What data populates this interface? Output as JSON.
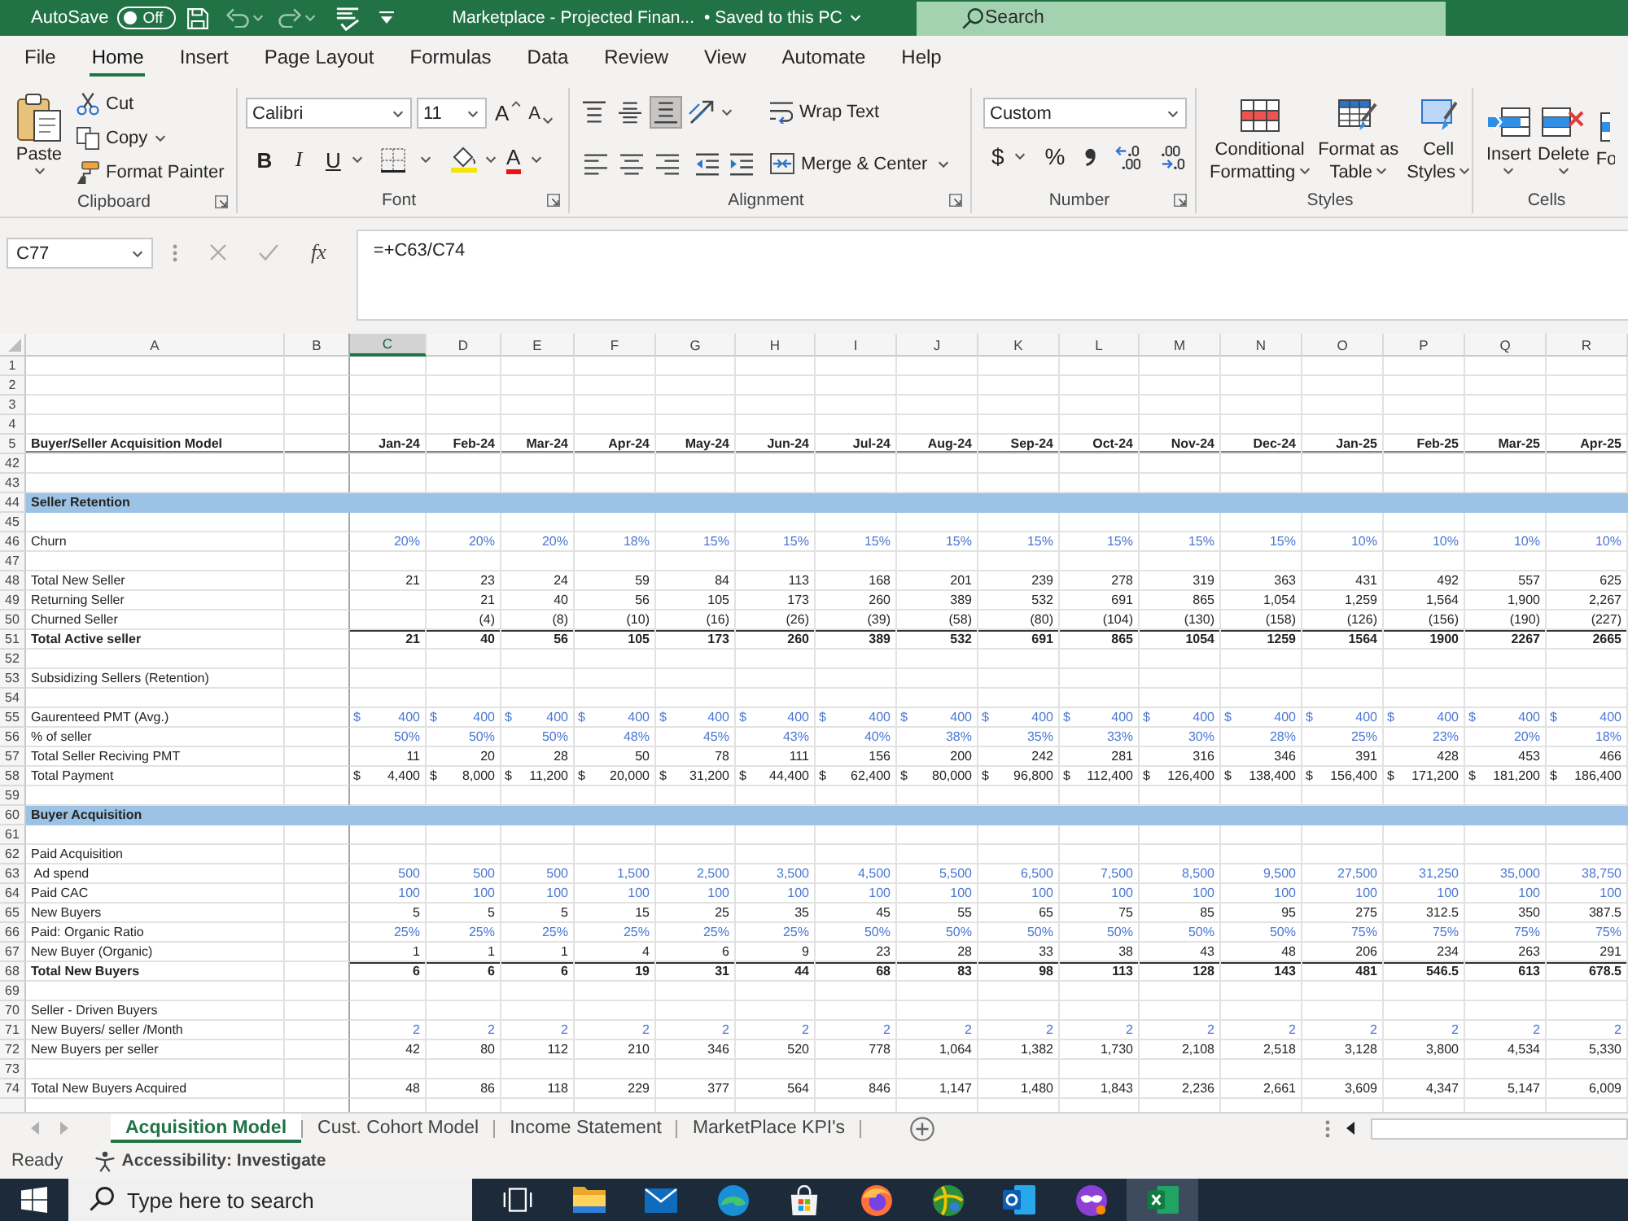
{
  "title_bar": {
    "autosave": {
      "label": "AutoSave",
      "state_text": "Off",
      "on": false
    },
    "title": "Marketplace - Projected Finan...",
    "save_status": "•  Saved to this PC",
    "search": {
      "placeholder": "Search"
    }
  },
  "menu_tabs": [
    {
      "label": "File",
      "selected": false
    },
    {
      "label": "Home",
      "selected": true
    },
    {
      "label": "Insert",
      "selected": false
    },
    {
      "label": "Page Layout",
      "selected": false
    },
    {
      "label": "Formulas",
      "selected": false
    },
    {
      "label": "Data",
      "selected": false
    },
    {
      "label": "Review",
      "selected": false
    },
    {
      "label": "View",
      "selected": false
    },
    {
      "label": "Automate",
      "selected": false
    },
    {
      "label": "Help",
      "selected": false
    }
  ],
  "ribbon": {
    "clipboard": {
      "title": "Clipboard",
      "paste": "Paste",
      "cut": "Cut",
      "copy": "Copy",
      "format_painter": "Format Painter"
    },
    "font": {
      "title": "Font",
      "font_name": "Calibri",
      "font_size": "11",
      "grow": "A",
      "shrink": "A",
      "bold": "B",
      "italic": "I",
      "underline": "U",
      "font_color": "A"
    },
    "alignment": {
      "title": "Alignment",
      "vertical": [
        {
          "kind": "top",
          "selected": false
        },
        {
          "kind": "middle",
          "selected": false
        },
        {
          "kind": "bottom",
          "selected": true
        }
      ],
      "wrap_text": "Wrap Text",
      "merge_center": "Merge & Center"
    },
    "number": {
      "title": "Number",
      "format": "Custom",
      "currency": "$",
      "percent": "%"
    },
    "styles": {
      "title": "Styles",
      "buttons": [
        {
          "kind": "conditional",
          "label": "Conditional\nFormatting"
        },
        {
          "kind": "table",
          "label": "Format as\nTable"
        },
        {
          "kind": "cell_styles",
          "label": "Cell\nStyles"
        }
      ]
    },
    "cells": {
      "title": "Cells",
      "buttons": [
        {
          "kind": "insert",
          "label": "Insert"
        },
        {
          "kind": "delete",
          "label": "Delete"
        },
        {
          "kind": "format",
          "label": "Fo"
        }
      ]
    }
  },
  "formula_bar": {
    "name_box": "C77",
    "fx": "fx",
    "formula": "=+C63/C74"
  },
  "sheet": {
    "columns": [
      {
        "label": "A",
        "selected": false
      },
      {
        "label": "B",
        "selected": false
      },
      {
        "label": "C",
        "selected": true
      },
      {
        "label": "D",
        "selected": false
      },
      {
        "label": "E",
        "selected": false
      },
      {
        "label": "F",
        "selected": false
      },
      {
        "label": "G",
        "selected": false
      },
      {
        "label": "H",
        "selected": false
      },
      {
        "label": "I",
        "selected": false
      },
      {
        "label": "J",
        "selected": false
      },
      {
        "label": "K",
        "selected": false
      },
      {
        "label": "L",
        "selected": false
      },
      {
        "label": "M",
        "selected": false
      },
      {
        "label": "N",
        "selected": false
      },
      {
        "label": "O",
        "selected": false
      },
      {
        "label": "P",
        "selected": false
      },
      {
        "label": "Q",
        "selected": false
      },
      {
        "label": "R",
        "selected": false
      }
    ],
    "rows": [
      {
        "number": "1",
        "kind": "blank"
      },
      {
        "number": "2",
        "kind": "blank"
      },
      {
        "number": "3",
        "kind": "blank"
      },
      {
        "number": "4",
        "kind": "blank"
      },
      {
        "number": "5",
        "kind": "dates",
        "label": "Buyer/Seller Acquisition Model",
        "cells": [
          "Jan-24",
          "Feb-24",
          "Mar-24",
          "Apr-24",
          "May-24",
          "Jun-24",
          "Jul-24",
          "Aug-24",
          "Sep-24",
          "Oct-24",
          "Nov-24",
          "Dec-24",
          "Jan-25",
          "Feb-25",
          "Mar-25",
          "Apr-25"
        ]
      },
      {
        "number": "42",
        "kind": "blank"
      },
      {
        "number": "43",
        "kind": "blank"
      },
      {
        "number": "44",
        "kind": "section",
        "label": "Seller Retention"
      },
      {
        "number": "45",
        "kind": "blank"
      },
      {
        "number": "46",
        "kind": "input",
        "label": "Churn",
        "cells": [
          "20%",
          "20%",
          "20%",
          "18%",
          "15%",
          "15%",
          "15%",
          "15%",
          "15%",
          "15%",
          "15%",
          "15%",
          "10%",
          "10%",
          "10%",
          "10%"
        ]
      },
      {
        "number": "47",
        "kind": "blank"
      },
      {
        "number": "48",
        "kind": "value",
        "label": "Total New Seller",
        "cells": [
          "21",
          "23",
          "24",
          "59",
          "84",
          "113",
          "168",
          "201",
          "239",
          "278",
          "319",
          "363",
          "431",
          "492",
          "557",
          "625"
        ]
      },
      {
        "number": "49",
        "kind": "value",
        "label": "Returning Seller",
        "cells": [
          null,
          "21",
          "40",
          "56",
          "105",
          "173",
          "260",
          "389",
          "532",
          "691",
          "865",
          "1,054",
          "1,259",
          "1,564",
          "1,900",
          "2,267"
        ]
      },
      {
        "number": "50",
        "kind": "value",
        "label": "Churned Seller",
        "cells": [
          null,
          "(4)",
          "(8)",
          "(10)",
          "(16)",
          "(26)",
          "(39)",
          "(58)",
          "(80)",
          "(104)",
          "(130)",
          "(158)",
          "(126)",
          "(156)",
          "(190)",
          "(227)"
        ]
      },
      {
        "number": "51",
        "kind": "total",
        "label": "Total Active seller",
        "cells": [
          "21",
          "40",
          "56",
          "105",
          "173",
          "260",
          "389",
          "532",
          "691",
          "865",
          "1054",
          "1259",
          "1564",
          "1900",
          "2267",
          "2665"
        ]
      },
      {
        "number": "52",
        "kind": "blank"
      },
      {
        "number": "53",
        "kind": "text",
        "label": "Subsidizing Sellers (Retention)"
      },
      {
        "number": "54",
        "kind": "blank"
      },
      {
        "number": "55",
        "kind": "input_currency",
        "label": "Gaurenteed PMT (Avg.)",
        "cells": [
          {
            "symbol": "$",
            "amount": "400"
          },
          {
            "symbol": "$",
            "amount": "400"
          },
          {
            "symbol": "$",
            "amount": "400"
          },
          {
            "symbol": "$",
            "amount": "400"
          },
          {
            "symbol": "$",
            "amount": "400"
          },
          {
            "symbol": "$",
            "amount": "400"
          },
          {
            "symbol": "$",
            "amount": "400"
          },
          {
            "symbol": "$",
            "amount": "400"
          },
          {
            "symbol": "$",
            "amount": "400"
          },
          {
            "symbol": "$",
            "amount": "400"
          },
          {
            "symbol": "$",
            "amount": "400"
          },
          {
            "symbol": "$",
            "amount": "400"
          },
          {
            "symbol": "$",
            "amount": "400"
          },
          {
            "symbol": "$",
            "amount": "400"
          },
          {
            "symbol": "$",
            "amount": "400"
          },
          {
            "symbol": "$",
            "amount": "400"
          }
        ]
      },
      {
        "number": "56",
        "kind": "input",
        "label": "% of seller",
        "cells": [
          "50%",
          "50%",
          "50%",
          "48%",
          "45%",
          "43%",
          "40%",
          "38%",
          "35%",
          "33%",
          "30%",
          "28%",
          "25%",
          "23%",
          "20%",
          "18%"
        ]
      },
      {
        "number": "57",
        "kind": "value",
        "label": "Total Seller Reciving PMT",
        "cells": [
          "11",
          "20",
          "28",
          "50",
          "78",
          "111",
          "156",
          "200",
          "242",
          "281",
          "316",
          "346",
          "391",
          "428",
          "453",
          "466"
        ]
      },
      {
        "number": "58",
        "kind": "currency",
        "label": "Total Payment",
        "cells": [
          {
            "symbol": "$",
            "amount": "4,400"
          },
          {
            "symbol": "$",
            "amount": "8,000"
          },
          {
            "symbol": "$",
            "amount": "11,200"
          },
          {
            "symbol": "$",
            "amount": "20,000"
          },
          {
            "symbol": "$",
            "amount": "31,200"
          },
          {
            "symbol": "$",
            "amount": "44,400"
          },
          {
            "symbol": "$",
            "amount": "62,400"
          },
          {
            "symbol": "$",
            "amount": "80,000"
          },
          {
            "symbol": "$",
            "amount": "96,800"
          },
          {
            "symbol": "$",
            "amount": "112,400"
          },
          {
            "symbol": "$",
            "amount": "126,400"
          },
          {
            "symbol": "$",
            "amount": "138,400"
          },
          {
            "symbol": "$",
            "amount": "156,400"
          },
          {
            "symbol": "$",
            "amount": "171,200"
          },
          {
            "symbol": "$",
            "amount": "181,200"
          },
          {
            "symbol": "$",
            "amount": "186,400"
          }
        ]
      },
      {
        "number": "59",
        "kind": "blank"
      },
      {
        "number": "60",
        "kind": "section",
        "label": "Buyer Acquisition"
      },
      {
        "number": "61",
        "kind": "blank"
      },
      {
        "number": "62",
        "kind": "text",
        "label": "Paid Acquisition"
      },
      {
        "number": "63",
        "kind": "input",
        "label": " Ad spend",
        "cells": [
          "500",
          "500",
          "500",
          "1,500",
          "2,500",
          "3,500",
          "4,500",
          "5,500",
          "6,500",
          "7,500",
          "8,500",
          "9,500",
          "27,500",
          "31,250",
          "35,000",
          "38,750"
        ]
      },
      {
        "number": "64",
        "kind": "input",
        "label": "Paid CAC",
        "cells": [
          "100",
          "100",
          "100",
          "100",
          "100",
          "100",
          "100",
          "100",
          "100",
          "100",
          "100",
          "100",
          "100",
          "100",
          "100",
          "100"
        ]
      },
      {
        "number": "65",
        "kind": "value",
        "label": "New Buyers",
        "cells": [
          "5",
          "5",
          "5",
          "15",
          "25",
          "35",
          "45",
          "55",
          "65",
          "75",
          "85",
          "95",
          "275",
          "312.5",
          "350",
          "387.5"
        ]
      },
      {
        "number": "66",
        "kind": "input",
        "label": "Paid: Organic Ratio",
        "cells": [
          "25%",
          "25%",
          "25%",
          "25%",
          "25%",
          "25%",
          "50%",
          "50%",
          "50%",
          "50%",
          "50%",
          "50%",
          "75%",
          "75%",
          "75%",
          "75%"
        ]
      },
      {
        "number": "67",
        "kind": "value",
        "label": "New Buyer (Organic)",
        "cells": [
          "1",
          "1",
          "1",
          "4",
          "6",
          "9",
          "23",
          "28",
          "33",
          "38",
          "43",
          "48",
          "206",
          "234",
          "263",
          "291"
        ]
      },
      {
        "number": "68",
        "kind": "total",
        "label": "Total New Buyers",
        "cells": [
          "6",
          "6",
          "6",
          "19",
          "31",
          "44",
          "68",
          "83",
          "98",
          "113",
          "128",
          "143",
          "481",
          "546.5",
          "613",
          "678.5"
        ]
      },
      {
        "number": "69",
        "kind": "blank"
      },
      {
        "number": "70",
        "kind": "text",
        "label": "Seller - Driven Buyers"
      },
      {
        "number": "71",
        "kind": "input",
        "label": "New Buyers/ seller /Month",
        "cells": [
          "2",
          "2",
          "2",
          "2",
          "2",
          "2",
          "2",
          "2",
          "2",
          "2",
          "2",
          "2",
          "2",
          "2",
          "2",
          "2"
        ]
      },
      {
        "number": "72",
        "kind": "value",
        "label": "New Buyers per seller",
        "cells": [
          "42",
          "80",
          "112",
          "210",
          "346",
          "520",
          "778",
          "1,064",
          "1,382",
          "1,730",
          "2,108",
          "2,518",
          "3,128",
          "3,800",
          "4,534",
          "5,330"
        ]
      },
      {
        "number": "73",
        "kind": "blank"
      },
      {
        "number": "74",
        "kind": "value",
        "label": "Total New Buyers Acquired",
        "cells": [
          "48",
          "86",
          "118",
          "229",
          "377",
          "564",
          "846",
          "1,147",
          "1,480",
          "1,843",
          "2,236",
          "2,661",
          "3,609",
          "4,347",
          "5,147",
          "6,009"
        ]
      }
    ]
  },
  "sheet_tabs": [
    {
      "label": "Acquisition Model",
      "selected": true
    },
    {
      "label": "Cust. Cohort Model",
      "selected": false
    },
    {
      "label": "Income Statement",
      "selected": false
    },
    {
      "label": "MarketPlace KPI's",
      "selected": false
    }
  ],
  "status_bar": {
    "status": "Ready",
    "accessibility": "Accessibility: Investigate"
  },
  "taskbar": {
    "search": {
      "placeholder": "Type here to search"
    },
    "apps": [
      {
        "kind": "task_view",
        "active": false
      },
      {
        "kind": "folder",
        "active": false
      },
      {
        "kind": "mail",
        "active": false
      },
      {
        "kind": "browser",
        "active": false
      },
      {
        "kind": "store",
        "active": false
      },
      {
        "kind": "fox",
        "active": false
      },
      {
        "kind": "globe",
        "active": false
      },
      {
        "kind": "outlook",
        "active": false
      },
      {
        "kind": "mask",
        "active": false
      },
      {
        "kind": "excel",
        "active": true
      }
    ]
  }
}
